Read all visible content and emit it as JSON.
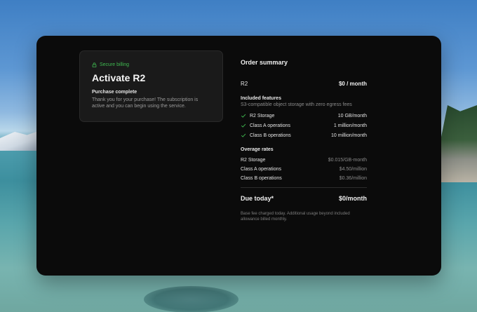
{
  "card": {
    "secure_label": "Secure billing",
    "title": "Activate R2",
    "status_title": "Purchase complete",
    "status_text": "Thank you for your purchase! The subscription is active and you can begin using the service."
  },
  "summary": {
    "title": "Order summary",
    "plan": {
      "name": "R2",
      "price": "$0 / month"
    },
    "included": {
      "title": "Included features",
      "description": "S3-compatible object storage with zero egress fees",
      "items": [
        {
          "label": "R2 Storage",
          "value": "10 GB/month"
        },
        {
          "label": "Class A operations",
          "value": "1 million/month"
        },
        {
          "label": "Class B operations",
          "value": "10 million/month"
        }
      ]
    },
    "overage": {
      "title": "Overage rates",
      "items": [
        {
          "label": "R2 Storage",
          "value": "$0.015/GB-month"
        },
        {
          "label": "Class A operations",
          "value": "$4.50/million"
        },
        {
          "label": "Class B operations",
          "value": "$0.36/million"
        }
      ]
    },
    "due": {
      "label": "Due today*",
      "value": "$0/month"
    },
    "note": "Base fee charged today. Additional usage beyond included allowance billed monthly."
  },
  "colors": {
    "accent_green": "#3fb950",
    "modal_bg": "#0b0b0b",
    "card_bg": "#1a1a1a"
  },
  "icons": {
    "secure": "lock-icon",
    "included": "check-icon"
  }
}
